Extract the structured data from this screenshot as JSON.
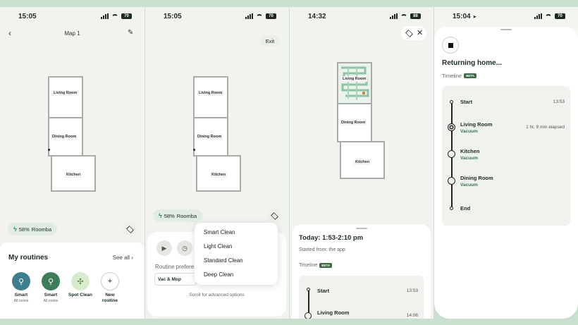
{
  "p1": {
    "time": "15:05",
    "title": "Map 1",
    "rooms": [
      "Living Room",
      "Dining Room",
      "Kitchen"
    ],
    "battery": "58%",
    "device": "Roomba",
    "routines_title": "My routines",
    "see_all": "See all",
    "routines": [
      {
        "name": "Smart",
        "sub": "All rooms",
        "color": "#3f7e8f"
      },
      {
        "name": "Smart",
        "sub": "All rooms",
        "color": "#3e7d5a"
      },
      {
        "name": "Spot Clean",
        "sub": "",
        "color": "#d8eccb"
      },
      {
        "name": "New routine",
        "sub": "",
        "color": "#ffffff"
      }
    ]
  },
  "p2": {
    "time": "15:05",
    "exit": "Exit",
    "rooms": [
      "Living Room",
      "Dining Room",
      "Kitchen"
    ],
    "battery": "58%",
    "device": "Roomba",
    "pref_label": "Routine prefere",
    "mode": "Vac & Mop",
    "scroll_hint": "Scroll for advanced options",
    "menu": [
      "Smart Clean",
      "Light Clean",
      "Standard Clean",
      "Deep Clean"
    ]
  },
  "p3": {
    "time": "14:32",
    "rooms": [
      "Living Room",
      "Dining Room",
      "Kitchen"
    ],
    "today": "Today: 1:53-2:10 pm",
    "from": "Started from: the app",
    "timeline": "Timeline",
    "beta": "BETA",
    "events": [
      {
        "name": "Start",
        "time": "13:53"
      },
      {
        "name": "Living Room",
        "time": "14:06"
      }
    ]
  },
  "p4": {
    "time": "15:04",
    "status": "Returning home...",
    "timeline": "Timeline",
    "beta": "BETA",
    "events": [
      {
        "name": "Start",
        "sub": "",
        "time": "13:53"
      },
      {
        "name": "Living Room",
        "sub": "Vacuum",
        "time": "1 hr, 9 min elapsed"
      },
      {
        "name": "Kitchen",
        "sub": "Vacuum",
        "time": ""
      },
      {
        "name": "Dining Room",
        "sub": "Vacuum",
        "time": ""
      },
      {
        "name": "End",
        "sub": "",
        "time": ""
      }
    ]
  },
  "colors": {
    "accent_green": "#2e8a55",
    "beta_bg": "#3e6a45",
    "background": "#c9dfcf"
  }
}
